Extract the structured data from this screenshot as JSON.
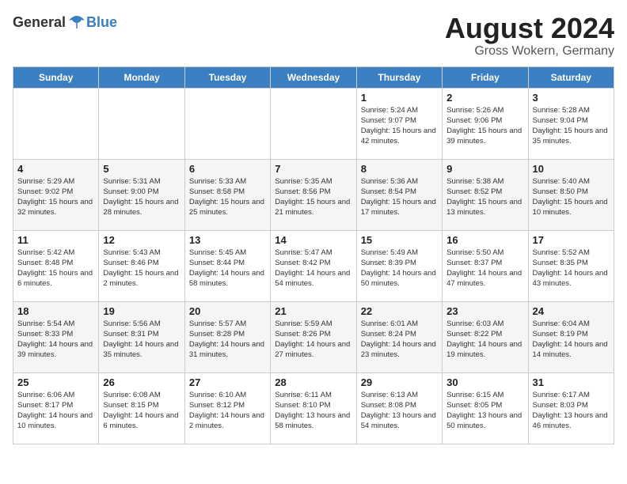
{
  "header": {
    "logo_general": "General",
    "logo_blue": "Blue",
    "title": "August 2024",
    "subtitle": "Gross Wokern, Germany"
  },
  "weekdays": [
    "Sunday",
    "Monday",
    "Tuesday",
    "Wednesday",
    "Thursday",
    "Friday",
    "Saturday"
  ],
  "weeks": [
    [
      {
        "day": "",
        "info": ""
      },
      {
        "day": "",
        "info": ""
      },
      {
        "day": "",
        "info": ""
      },
      {
        "day": "",
        "info": ""
      },
      {
        "day": "1",
        "info": "Sunrise: 5:24 AM\nSunset: 9:07 PM\nDaylight: 15 hours\nand 42 minutes."
      },
      {
        "day": "2",
        "info": "Sunrise: 5:26 AM\nSunset: 9:06 PM\nDaylight: 15 hours\nand 39 minutes."
      },
      {
        "day": "3",
        "info": "Sunrise: 5:28 AM\nSunset: 9:04 PM\nDaylight: 15 hours\nand 35 minutes."
      }
    ],
    [
      {
        "day": "4",
        "info": "Sunrise: 5:29 AM\nSunset: 9:02 PM\nDaylight: 15 hours\nand 32 minutes."
      },
      {
        "day": "5",
        "info": "Sunrise: 5:31 AM\nSunset: 9:00 PM\nDaylight: 15 hours\nand 28 minutes."
      },
      {
        "day": "6",
        "info": "Sunrise: 5:33 AM\nSunset: 8:58 PM\nDaylight: 15 hours\nand 25 minutes."
      },
      {
        "day": "7",
        "info": "Sunrise: 5:35 AM\nSunset: 8:56 PM\nDaylight: 15 hours\nand 21 minutes."
      },
      {
        "day": "8",
        "info": "Sunrise: 5:36 AM\nSunset: 8:54 PM\nDaylight: 15 hours\nand 17 minutes."
      },
      {
        "day": "9",
        "info": "Sunrise: 5:38 AM\nSunset: 8:52 PM\nDaylight: 15 hours\nand 13 minutes."
      },
      {
        "day": "10",
        "info": "Sunrise: 5:40 AM\nSunset: 8:50 PM\nDaylight: 15 hours\nand 10 minutes."
      }
    ],
    [
      {
        "day": "11",
        "info": "Sunrise: 5:42 AM\nSunset: 8:48 PM\nDaylight: 15 hours\nand 6 minutes."
      },
      {
        "day": "12",
        "info": "Sunrise: 5:43 AM\nSunset: 8:46 PM\nDaylight: 15 hours\nand 2 minutes."
      },
      {
        "day": "13",
        "info": "Sunrise: 5:45 AM\nSunset: 8:44 PM\nDaylight: 14 hours\nand 58 minutes."
      },
      {
        "day": "14",
        "info": "Sunrise: 5:47 AM\nSunset: 8:42 PM\nDaylight: 14 hours\nand 54 minutes."
      },
      {
        "day": "15",
        "info": "Sunrise: 5:49 AM\nSunset: 8:39 PM\nDaylight: 14 hours\nand 50 minutes."
      },
      {
        "day": "16",
        "info": "Sunrise: 5:50 AM\nSunset: 8:37 PM\nDaylight: 14 hours\nand 47 minutes."
      },
      {
        "day": "17",
        "info": "Sunrise: 5:52 AM\nSunset: 8:35 PM\nDaylight: 14 hours\nand 43 minutes."
      }
    ],
    [
      {
        "day": "18",
        "info": "Sunrise: 5:54 AM\nSunset: 8:33 PM\nDaylight: 14 hours\nand 39 minutes."
      },
      {
        "day": "19",
        "info": "Sunrise: 5:56 AM\nSunset: 8:31 PM\nDaylight: 14 hours\nand 35 minutes."
      },
      {
        "day": "20",
        "info": "Sunrise: 5:57 AM\nSunset: 8:28 PM\nDaylight: 14 hours\nand 31 minutes."
      },
      {
        "day": "21",
        "info": "Sunrise: 5:59 AM\nSunset: 8:26 PM\nDaylight: 14 hours\nand 27 minutes."
      },
      {
        "day": "22",
        "info": "Sunrise: 6:01 AM\nSunset: 8:24 PM\nDaylight: 14 hours\nand 23 minutes."
      },
      {
        "day": "23",
        "info": "Sunrise: 6:03 AM\nSunset: 8:22 PM\nDaylight: 14 hours\nand 19 minutes."
      },
      {
        "day": "24",
        "info": "Sunrise: 6:04 AM\nSunset: 8:19 PM\nDaylight: 14 hours\nand 14 minutes."
      }
    ],
    [
      {
        "day": "25",
        "info": "Sunrise: 6:06 AM\nSunset: 8:17 PM\nDaylight: 14 hours\nand 10 minutes."
      },
      {
        "day": "26",
        "info": "Sunrise: 6:08 AM\nSunset: 8:15 PM\nDaylight: 14 hours\nand 6 minutes."
      },
      {
        "day": "27",
        "info": "Sunrise: 6:10 AM\nSunset: 8:12 PM\nDaylight: 14 hours\nand 2 minutes."
      },
      {
        "day": "28",
        "info": "Sunrise: 6:11 AM\nSunset: 8:10 PM\nDaylight: 13 hours\nand 58 minutes."
      },
      {
        "day": "29",
        "info": "Sunrise: 6:13 AM\nSunset: 8:08 PM\nDaylight: 13 hours\nand 54 minutes."
      },
      {
        "day": "30",
        "info": "Sunrise: 6:15 AM\nSunset: 8:05 PM\nDaylight: 13 hours\nand 50 minutes."
      },
      {
        "day": "31",
        "info": "Sunrise: 6:17 AM\nSunset: 8:03 PM\nDaylight: 13 hours\nand 46 minutes."
      }
    ]
  ]
}
